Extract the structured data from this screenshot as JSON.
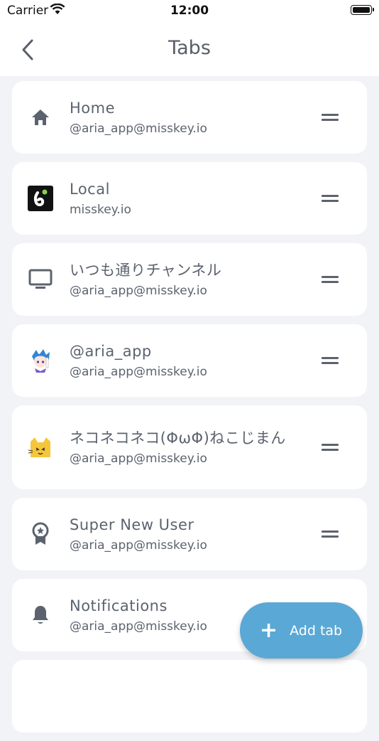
{
  "status_bar": {
    "carrier": "Carrier",
    "time": "12:00"
  },
  "nav": {
    "title": "Tabs"
  },
  "tabs": [
    {
      "icon": "home-icon",
      "title": "Home",
      "subtitle": "@aria_app@misskey.io"
    },
    {
      "icon": "misskey-logo-icon",
      "title": "Local",
      "subtitle": "misskey.io"
    },
    {
      "icon": "tv-icon",
      "title": "いつも通りチャンネル",
      "subtitle": "@aria_app@misskey.io"
    },
    {
      "icon": "user-avatar-icon",
      "title": "@aria_app",
      "subtitle": "@aria_app@misskey.io"
    },
    {
      "icon": "cat-avatar-icon",
      "title": "ネコネコネコ(ΦωΦ)ねこじまん",
      "subtitle": "@aria_app@misskey.io"
    },
    {
      "icon": "award-icon",
      "title": "Super New User",
      "subtitle": "@aria_app@misskey.io"
    },
    {
      "icon": "bell-icon",
      "title": "Notifications",
      "subtitle": "@aria_app@misskey.io"
    }
  ],
  "fab": {
    "label": "Add tab",
    "icon": "plus-icon"
  },
  "colors": {
    "accent": "#5aa8d5",
    "background": "#f2f3f6",
    "text": "#5c636e"
  }
}
